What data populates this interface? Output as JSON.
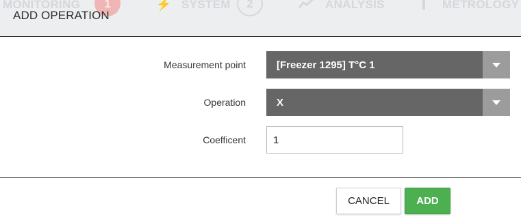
{
  "background_nav": {
    "items": [
      {
        "label": "MONITORING",
        "badge": "1"
      },
      {
        "label": "SYSTEM",
        "badge": "2"
      },
      {
        "label": "ANALYSIS"
      },
      {
        "label": "METROLOGY"
      }
    ]
  },
  "modal": {
    "title": "ADD OPERATION",
    "fields": {
      "measurement_point": {
        "label": "Measurement point",
        "value": "[Freezer 1295] T°C 1"
      },
      "operation": {
        "label": "Operation",
        "value": "X"
      },
      "coefficient": {
        "label": "Coefficent",
        "value": "1"
      }
    },
    "buttons": {
      "cancel": "CANCEL",
      "add": "ADD"
    }
  },
  "colors": {
    "select_bg": "#666666",
    "select_arrow_bg": "#9c9c9c",
    "add_button": "#4caf50",
    "badge_red": "#f0b6b6"
  }
}
